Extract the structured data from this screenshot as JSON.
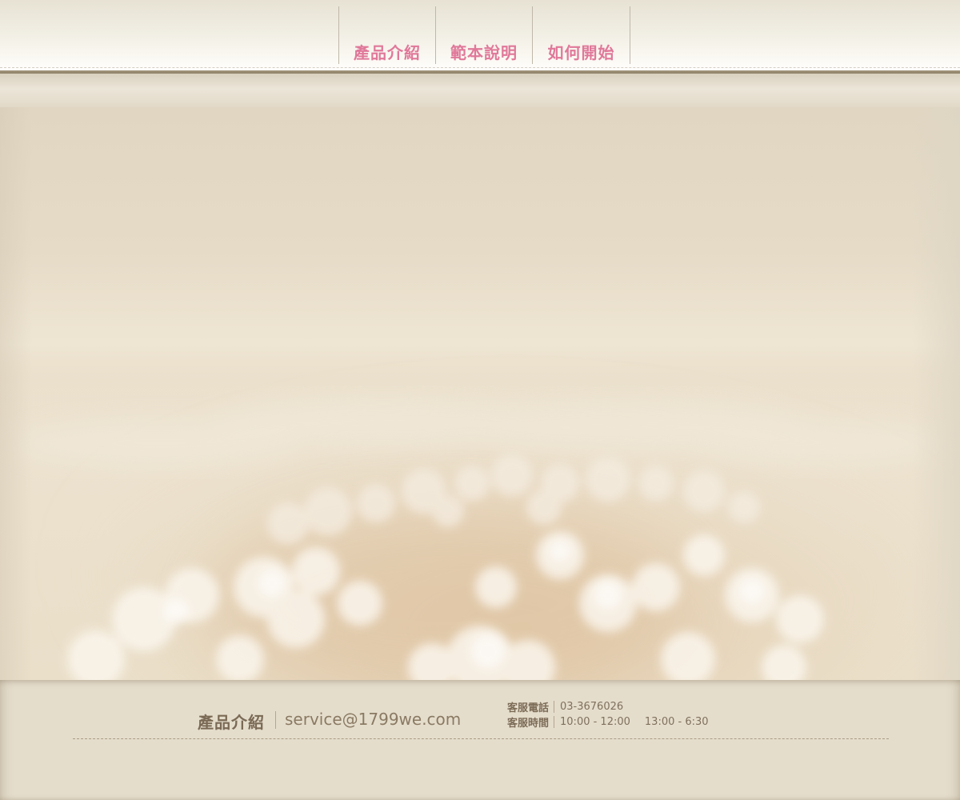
{
  "nav": {
    "items": [
      {
        "label": "產品介紹"
      },
      {
        "label": "範本說明"
      },
      {
        "label": "如何開始"
      }
    ]
  },
  "footer": {
    "brand": "產品介紹",
    "email": "service@1799we.com",
    "phone_label": "客服電話",
    "phone_value": "03-3676026",
    "hours_label": "客服時間",
    "hours_morning": "10:00 - 12:00",
    "hours_afternoon": "13:00 - 6:30"
  },
  "colors": {
    "nav_text": "#e0789a",
    "footer_text": "#7a6a55",
    "background": "#e4dccb",
    "header_bar": "#8e816a"
  }
}
